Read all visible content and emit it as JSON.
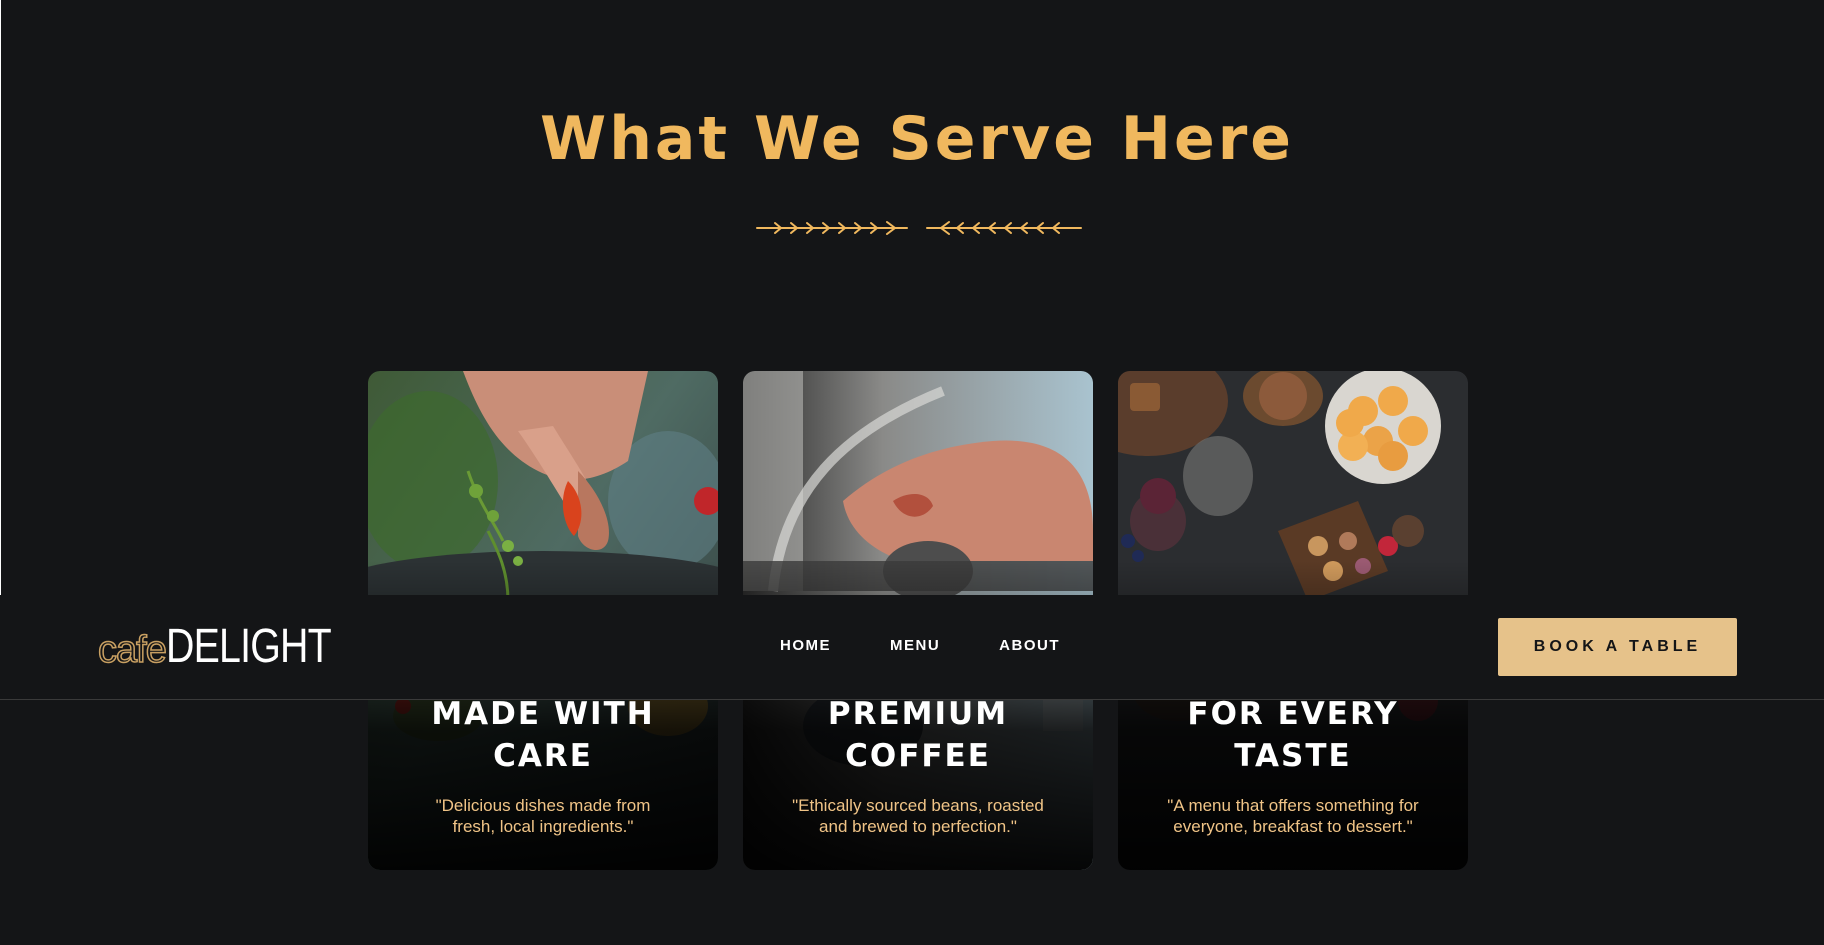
{
  "section": {
    "title": "What We Serve Here",
    "divider_icon": "arrow-divider-icon"
  },
  "cards": [
    {
      "title_line1": "MADE WITH",
      "title_line2": "CARE",
      "text_line1": "\"Delicious dishes made from",
      "text_line2": "fresh, local ingredients.\"",
      "photo": "chef-plating-food-image"
    },
    {
      "title_line1": "PREMIUM",
      "title_line2": "COFFEE",
      "text_line1": "\"Ethically sourced beans, roasted",
      "text_line2": "and brewed to perfection.\"",
      "photo": "espresso-machine-image"
    },
    {
      "title_line1": "FOR EVERY",
      "title_line2": "TASTE",
      "text_line1": "\"A menu that offers something for",
      "text_line2": "everyone, breakfast to dessert.\"",
      "photo": "dessert-table-image"
    }
  ],
  "navbar": {
    "logo_small": "cafe",
    "logo_large": "DELIGHT",
    "links": [
      {
        "label": "HOME"
      },
      {
        "label": "MENU"
      },
      {
        "label": "ABOUT"
      }
    ],
    "cta_label": "BOOK A TABLE"
  },
  "colors": {
    "background": "#141517",
    "accent_gold": "#f0b85e",
    "button_beige": "#e6c28a",
    "caption_gold": "#f0c487"
  }
}
